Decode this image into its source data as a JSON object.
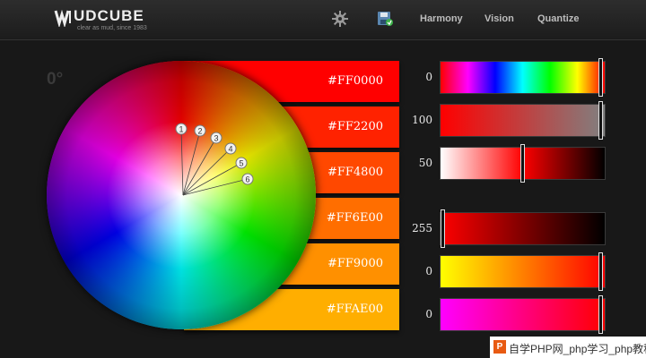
{
  "header": {
    "logo_title": "UDCUBE",
    "logo_tagline": "clear as mud, since 1983",
    "nav": [
      "Harmony",
      "Vision",
      "Quantize"
    ],
    "icons": [
      "gear-icon",
      "save-icon"
    ]
  },
  "wheel": {
    "angle_label": "0°",
    "markers": [
      "1",
      "2",
      "3",
      "4",
      "5",
      "6"
    ]
  },
  "swatches": [
    {
      "hex": "#FF0000",
      "color": "#ff0000"
    },
    {
      "hex": "#FF2200",
      "color": "#ff2200"
    },
    {
      "hex": "#FF4800",
      "color": "#ff4800"
    },
    {
      "hex": "#FF6E00",
      "color": "#ff6e00"
    },
    {
      "hex": "#FF9000",
      "color": "#ff9000"
    },
    {
      "hex": "#FFAE00",
      "color": "#ffae00"
    }
  ],
  "sliders": [
    {
      "label": "0",
      "value": 0.99
    },
    {
      "label": "100",
      "value": 0.99
    },
    {
      "label": "50",
      "value": 0.5
    },
    {
      "label": "255",
      "value": 0.0
    },
    {
      "label": "0",
      "value": 0.99
    },
    {
      "label": "0",
      "value": 0.99
    }
  ],
  "watermark": {
    "icon": "P",
    "text": "自学PHP网_php学习_php教程"
  }
}
